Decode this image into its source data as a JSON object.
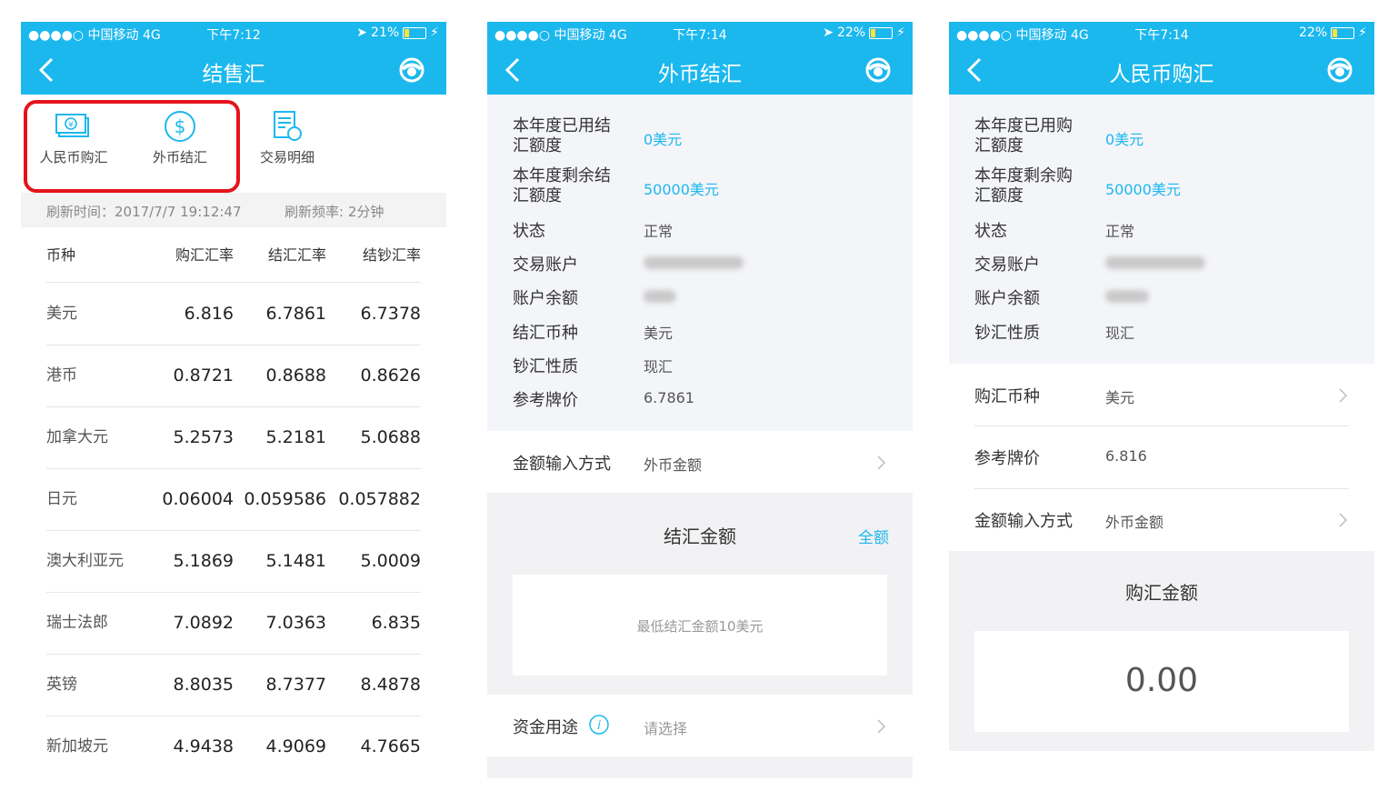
{
  "status1": {
    "carrier": "●●●●○ 中国移动  4G",
    "time": "下午7:12",
    "battery": "21%"
  },
  "status2": {
    "carrier": "●●●●○ 中国移动  4G",
    "time": "下午7:14",
    "battery": "22%"
  },
  "status3": {
    "carrier": "●●●●○ 中国移动  4G",
    "time": "下午7:14",
    "battery": "22%"
  },
  "screen1": {
    "title": "结售汇",
    "tiles": [
      {
        "label": "人民币购汇",
        "icon": "banknote-yen-icon"
      },
      {
        "label": "外币结汇",
        "icon": "dollar-coin-icon"
      },
      {
        "label": "交易明细",
        "icon": "transaction-list-icon"
      }
    ],
    "refresh_time": "刷新时间：2017/7/7 19:12:47",
    "refresh_freq": "刷新频率: 2分钟",
    "headers": [
      "币种",
      "购汇汇率",
      "结汇汇率",
      "结钞汇率"
    ],
    "rows": [
      [
        "美元",
        "6.816",
        "6.7861",
        "6.7378"
      ],
      [
        "港币",
        "0.8721",
        "0.8688",
        "0.8626"
      ],
      [
        "加拿大元",
        "5.2573",
        "5.2181",
        "5.0688"
      ],
      [
        "日元",
        "0.06004",
        "0.059586",
        "0.057882"
      ],
      [
        "澳大利亚元",
        "5.1869",
        "5.1481",
        "5.0009"
      ],
      [
        "瑞士法郎",
        "7.0892",
        "7.0363",
        "6.835"
      ],
      [
        "英镑",
        "8.8035",
        "8.7377",
        "8.4878"
      ],
      [
        "新加坡元",
        "4.9438",
        "4.9069",
        "4.7665"
      ]
    ]
  },
  "screen2": {
    "title": "外币结汇",
    "used_label": "本年度已用结\n汇额度",
    "used_value": "0美元",
    "remain_label": "本年度剩余结\n汇额度",
    "remain_value": "50000美元",
    "status_label": "状态",
    "status_value": "正常",
    "account_label": "交易账户",
    "balance_label": "账户余额",
    "currency_label": "结汇币种",
    "currency_value": "美元",
    "nature_label": "钞汇性质",
    "nature_value": "现汇",
    "price_label": "参考牌价",
    "price_value": "6.7861",
    "method_label": "金额输入方式",
    "method_value": "外币金额",
    "amount_title": "结汇金额",
    "all_link": "全额",
    "amount_placeholder": "最低结汇金额10美元",
    "purpose_label": "资金用途",
    "purpose_value": "请选择"
  },
  "screen3": {
    "title": "人民币购汇",
    "used_label": "本年度已用购\n汇额度",
    "used_value": "0美元",
    "remain_label": "本年度剩余购\n汇额度",
    "remain_value": "50000美元",
    "status_label": "状态",
    "status_value": "正常",
    "account_label": "交易账户",
    "balance_label": "账户余额",
    "nature_label": "钞汇性质",
    "nature_value": "现汇",
    "currency_label": "购汇币种",
    "currency_value": "美元",
    "price_label": "参考牌价",
    "price_value": "6.816",
    "method_label": "金额输入方式",
    "method_value": "外币金额",
    "amount_title": "购汇金额",
    "amount_value": "0.00"
  }
}
